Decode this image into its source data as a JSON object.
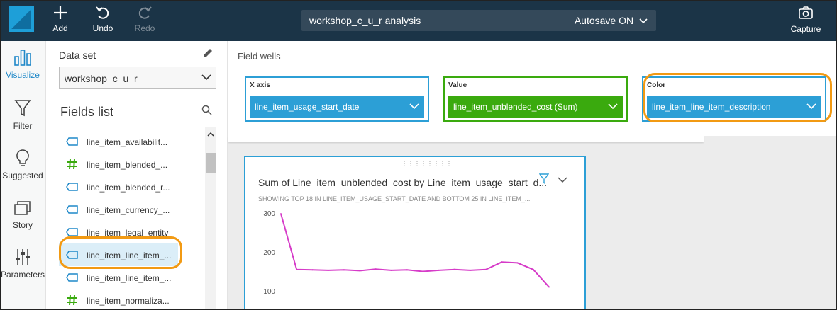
{
  "topbar": {
    "add_label": "Add",
    "undo_label": "Undo",
    "redo_label": "Redo",
    "analysis_title": "workshop_c_u_r analysis",
    "autosave_label": "Autosave ON",
    "capture_label": "Capture",
    "colors": {
      "bar": "#1b3447",
      "logo": "#1e9fd8",
      "search_bg": "#34495a"
    }
  },
  "nav": {
    "items": [
      {
        "label": "Visualize",
        "icon": "bar-chart-icon",
        "active": true
      },
      {
        "label": "Filter",
        "icon": "filter-icon",
        "active": false
      },
      {
        "label": "Suggested",
        "icon": "lightbulb-icon",
        "active": false
      },
      {
        "label": "Story",
        "icon": "story-icon",
        "active": false
      },
      {
        "label": "Parameters",
        "icon": "sliders-icon",
        "active": false
      }
    ],
    "accent": "#1e88c8"
  },
  "data_panel": {
    "dataset_label": "Data set",
    "dataset_value": "workshop_c_u_r",
    "fields_title": "Fields list",
    "fields": [
      {
        "name": "line_item_availabilit...",
        "type": "dimension",
        "selected": false
      },
      {
        "name": "line_item_blended_...",
        "type": "measure",
        "selected": false
      },
      {
        "name": "line_item_blended_r...",
        "type": "dimension",
        "selected": false
      },
      {
        "name": "line_item_currency_...",
        "type": "dimension",
        "selected": false
      },
      {
        "name": "line_item_legal_entity",
        "type": "dimension",
        "selected": false
      },
      {
        "name": "line_item_line_item_...",
        "type": "dimension",
        "selected": true
      },
      {
        "name": "line_item_line_item_...",
        "type": "dimension",
        "selected": false
      },
      {
        "name": "line_item_normaliza...",
        "type": "measure",
        "selected": false
      }
    ]
  },
  "field_wells": {
    "title": "Field wells",
    "x_axis": {
      "label": "X axis",
      "value": "line_item_usage_start_date",
      "color": "#2c9fd6"
    },
    "value": {
      "label": "Value",
      "value": "line_item_unblended_cost (Sum)",
      "color": "#3aaa0e"
    },
    "color": {
      "label": "Color",
      "value": "line_item_line_item_description",
      "color": "#2c9fd6"
    }
  },
  "visual": {
    "title": "Sum of Line_item_unblended_cost by Line_item_usage_start_d...",
    "subtitle": "SHOWING TOP 18 IN LINE_ITEM_USAGE_START_DATE AND BOTTOM 25 IN LINE_ITEM_..."
  },
  "chart_data": {
    "type": "line",
    "y_ticks": [
      "300",
      "200",
      "100"
    ],
    "ylim": [
      90,
      305
    ],
    "values": [
      298,
      155,
      154,
      153,
      154,
      152,
      156,
      153,
      154,
      150,
      153,
      155,
      153,
      155,
      174,
      172,
      155,
      110
    ],
    "line_color": "#d63bc8",
    "grid": false
  },
  "highlight_color": "#f29a13"
}
